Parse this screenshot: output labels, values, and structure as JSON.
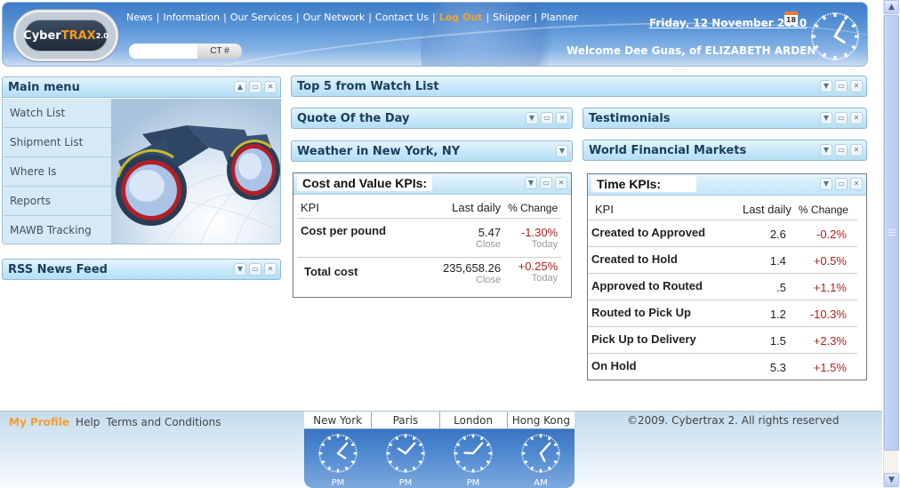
{
  "header": {
    "logo": {
      "name": "Cyber",
      "accent": "TRAX",
      "version": "2.0"
    },
    "nav": [
      {
        "label": "News"
      },
      {
        "label": "Information"
      },
      {
        "label": "Our Services"
      },
      {
        "label": "Our Network"
      },
      {
        "label": "Contact Us"
      },
      {
        "label": "Log Out",
        "highlight": true
      },
      {
        "label": "Shipper"
      },
      {
        "label": "Planner"
      }
    ],
    "search": {
      "value": "",
      "button_label": "CT #"
    },
    "date": "Friday, 12 November 2010",
    "calendar_day": "18",
    "welcome": "Welcome Dee Guas, of ELIZABETH ARDEN",
    "clock": {
      "hour": 4,
      "minute": 5
    }
  },
  "main_menu": {
    "title": "Main menu",
    "items": [
      {
        "label": "Watch List"
      },
      {
        "label": "Shipment List"
      },
      {
        "label": "Where Is"
      },
      {
        "label": "Reports"
      },
      {
        "label": "MAWB Tracking"
      }
    ]
  },
  "panels": {
    "rss": {
      "title": "RSS News Feed"
    },
    "top5": {
      "title": "Top 5 from Watch List"
    },
    "quote": {
      "title": "Quote Of the Day"
    },
    "weather": {
      "title": "Weather in New York, NY"
    },
    "testimonials": {
      "title": "Testimonials"
    },
    "markets": {
      "title": "World Financial Markets"
    }
  },
  "cost_kpis": {
    "title": "Cost and Value KPIs:",
    "columns": [
      "KPI",
      "Last daily",
      "% Change"
    ],
    "rows": [
      {
        "name": "Cost per pound",
        "value": "5.47",
        "value_sub": "Close",
        "change": "-1.30%",
        "change_sub": "Today"
      },
      {
        "name": "Total cost",
        "value": "235,658.26",
        "value_sub": "Close",
        "change": "+0.25%",
        "change_sub": "Today"
      }
    ]
  },
  "time_kpis": {
    "title": "Time KPIs:",
    "columns": [
      "KPI",
      "Last daily",
      "% Change"
    ],
    "rows": [
      {
        "name": "Created to Approved",
        "value": "2.6",
        "change": "-0.2%"
      },
      {
        "name": "Created to Hold",
        "value": "1.4",
        "change": "+0.5%"
      },
      {
        "name": "Approved to Routed",
        "value": ".5",
        "change": "+1.1%"
      },
      {
        "name": "Routed to Pick Up",
        "value": "1.2",
        "change": "-10.3%"
      },
      {
        "name": "Pick Up to Delivery",
        "value": "1.5",
        "change": "+2.3%"
      },
      {
        "name": "On Hold",
        "value": "5.3",
        "change": "+1.5%"
      }
    ]
  },
  "footer": {
    "links": [
      {
        "label": "My Profile",
        "highlight": true
      },
      {
        "label": "Help"
      },
      {
        "label": "Terms and Conditions"
      }
    ],
    "copyright": "©2009. Cybertrax 2. All rights reserved",
    "world_clocks": [
      {
        "city": "New York",
        "hour": 4,
        "minute": 7,
        "ampm": "PM"
      },
      {
        "city": "Paris",
        "hour": 10,
        "minute": 7,
        "ampm": "PM"
      },
      {
        "city": "London",
        "hour": 9,
        "minute": 7,
        "ampm": "PM"
      },
      {
        "city": "Hong Kong",
        "hour": 5,
        "minute": 7,
        "ampm": "AM"
      }
    ]
  },
  "colors": {
    "accent_orange": "#f5a623",
    "negative_red": "#b02020",
    "panel_title": "#1a3e5c"
  }
}
